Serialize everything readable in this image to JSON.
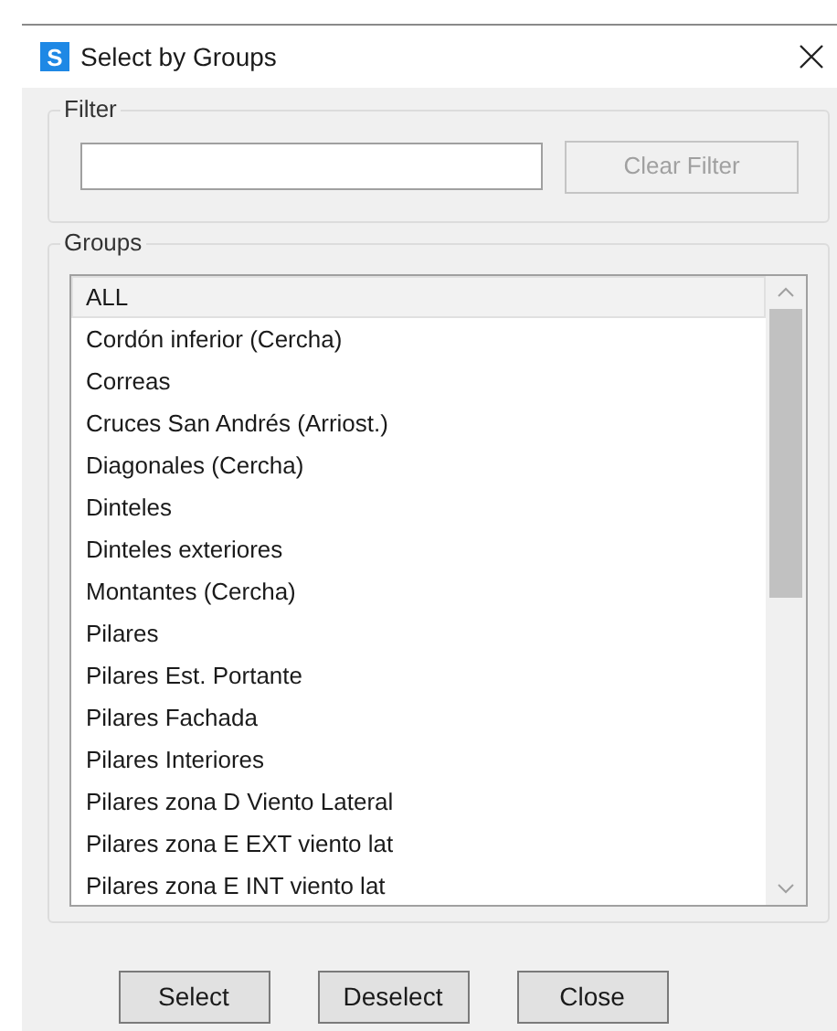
{
  "window": {
    "title": "Select by Groups",
    "app_letter": "S"
  },
  "filter": {
    "label": "Filter",
    "clear_button": {
      "label": "Clear Filter",
      "disabled": true
    }
  },
  "groups": {
    "label": "Groups",
    "items": [
      {
        "label": "ALL",
        "selected": true
      },
      {
        "label": "Cordón inferior (Cercha)",
        "selected": false
      },
      {
        "label": "Correas",
        "selected": false
      },
      {
        "label": "Cruces San Andrés (Arriost.)",
        "selected": false
      },
      {
        "label": "Diagonales (Cercha)",
        "selected": false
      },
      {
        "label": "Dinteles",
        "selected": false
      },
      {
        "label": "Dinteles exteriores",
        "selected": false
      },
      {
        "label": "Montantes (Cercha)",
        "selected": false
      },
      {
        "label": "Pilares",
        "selected": false
      },
      {
        "label": "Pilares Est. Portante",
        "selected": false
      },
      {
        "label": "Pilares Fachada",
        "selected": false
      },
      {
        "label": "Pilares Interiores",
        "selected": false
      },
      {
        "label": "Pilares zona D Viento Lateral",
        "selected": false
      },
      {
        "label": "Pilares zona E EXT viento lat",
        "selected": false
      },
      {
        "label": "Pilares zona E INT viento lat",
        "selected": false
      }
    ]
  },
  "buttons": [
    {
      "label": "Select"
    },
    {
      "label": "Deselect"
    },
    {
      "label": "Close"
    }
  ]
}
